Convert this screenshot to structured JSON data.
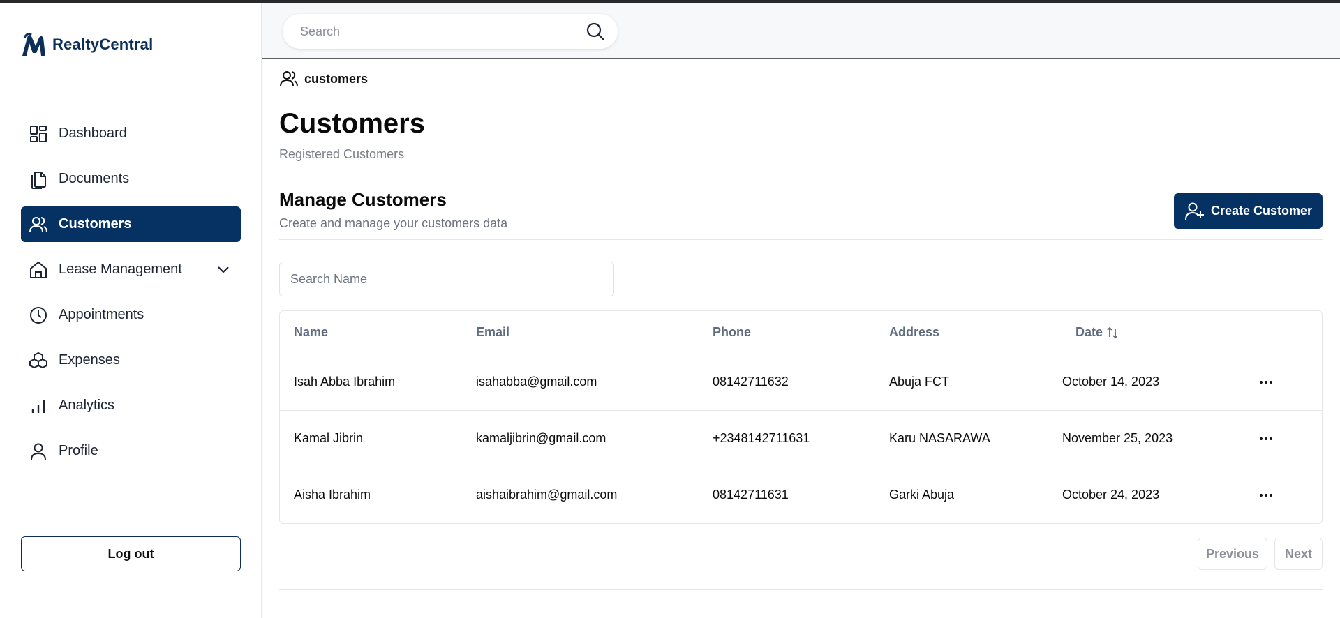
{
  "app": {
    "name": "RealtyCentral",
    "brand_color": "#053163"
  },
  "header": {
    "search_placeholder": "Search"
  },
  "sidebar": {
    "items": [
      {
        "label": "Dashboard",
        "icon": "dashboard-icon"
      },
      {
        "label": "Documents",
        "icon": "documents-icon"
      },
      {
        "label": "Customers",
        "icon": "users-icon",
        "active": true
      },
      {
        "label": "Lease Management",
        "icon": "home-icon",
        "expandable": true
      },
      {
        "label": "Appointments",
        "icon": "clock-icon"
      },
      {
        "label": "Expenses",
        "icon": "boxes-icon"
      },
      {
        "label": "Analytics",
        "icon": "bar-chart-icon"
      },
      {
        "label": "Profile",
        "icon": "user-icon"
      }
    ],
    "logout_label": "Log out"
  },
  "breadcrumb": {
    "label": "customers"
  },
  "page": {
    "title": "Customers",
    "subtitle": "Registered Customers"
  },
  "section": {
    "title": "Manage Customers",
    "subtitle": "Create and manage your customers data",
    "create_label": "Create Customer"
  },
  "filter": {
    "placeholder": "Search Name"
  },
  "table": {
    "columns": [
      "Name",
      "Email",
      "Phone",
      "Address",
      "Date"
    ],
    "rows": [
      {
        "name": "Isah Abba Ibrahim",
        "email": "isahabba@gmail.com",
        "phone": "08142711632",
        "address": "Abuja FCT",
        "date": "October 14, 2023"
      },
      {
        "name": "Kamal Jibrin",
        "email": "kamaljibrin@gmail.com",
        "phone": "+2348142711631",
        "address": "Karu NASARAWA",
        "date": "November 25, 2023"
      },
      {
        "name": "Aisha Ibrahim",
        "email": "aishaibrahim@gmail.com",
        "phone": "08142711631",
        "address": "Garki Abuja",
        "date": "October 24, 2023"
      }
    ]
  },
  "pagination": {
    "previous_label": "Previous",
    "next_label": "Next"
  }
}
